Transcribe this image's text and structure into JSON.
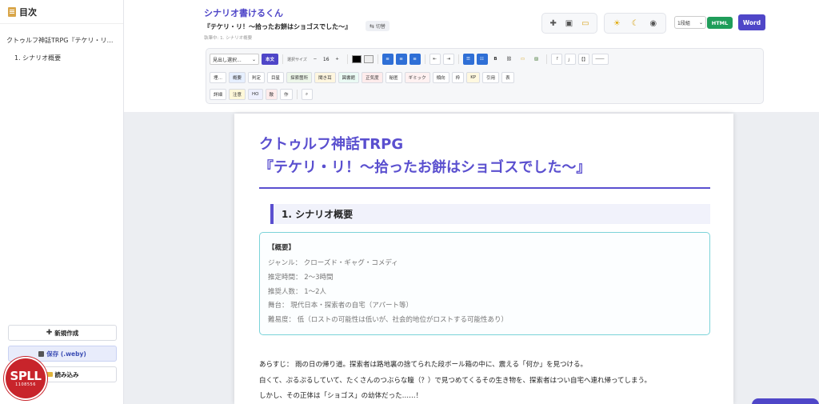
{
  "sidebar": {
    "toc_title": "目次",
    "items": [
      {
        "label": "クトゥルフ神話TRPG『テケリ・リ！～拾..."
      },
      {
        "label": "1. シナリオ概要"
      }
    ],
    "buttons": {
      "new": "新規作成",
      "save": "保存 (.weby)",
      "load": "読み込み"
    },
    "logo": {
      "line1": "SPLL",
      "line2": "1108556"
    }
  },
  "header": {
    "app_title": "シナリオ書けるくん",
    "doc_title": "『テケリ・リ！～拾ったお餅はショゴスでした～』",
    "editing": "執筆中: 1. シナリオ概要",
    "switch": "切替",
    "level": "1段組",
    "html": "HTML",
    "word": "Word"
  },
  "toolbar": {
    "heading_select": "見出し選択...",
    "body_text": "本文",
    "size_label": "選択サイズ",
    "minus": "−",
    "font_size": "16",
    "plus": "+",
    "bold": "B",
    "quote_open": "「",
    "quote_close": "」",
    "brackets": "【】",
    "dash": "――",
    "row2": [
      "埋…",
      "概要",
      "判定",
      "目星",
      "探索箇所",
      "聞き耳",
      "図書館",
      "正気度",
      "秘匿",
      "ギミック",
      "傾向",
      "枠",
      "KP",
      "引用",
      "表"
    ],
    "row3": [
      "詳細",
      "注意",
      "HO",
      "敵",
      "作"
    ]
  },
  "document": {
    "title_line1": "クトゥルフ神話TRPG",
    "title_line2": "『テケリ・リ！～拾ったお餅はショゴスでした～』",
    "section": "1. シナリオ概要",
    "summary_heading": "【概要】",
    "summary_lines": [
      "ジャンル： クローズド・ギャグ・コメディ",
      "推定時間： 2〜3時間",
      "推奨人数： 1〜2人",
      "舞台： 現代日本・探索者の自宅（アパート等）",
      "難易度： 低（ロストの可能性は低いが、社会的地位がロストする可能性あり）"
    ],
    "story_lines": [
      "あらすじ： 雨の日の帰り道。探索者は路地裏の捨てられた段ボール箱の中に、震える「何か」を見つける。",
      "白くて、ぷるぷるしていて、たくさんのつぶらな瞳（？）で見つめてくるその生き物を、探索者はつい自宅へ連れ帰ってしまう。",
      "しかし、その正体は「ショゴス」の幼体だった……！"
    ]
  },
  "colors": {
    "accent": "#4f46c8",
    "heading": "#5a4fcf",
    "html_button": "#1f9d5a",
    "summary_border": "#7bd3d9"
  }
}
